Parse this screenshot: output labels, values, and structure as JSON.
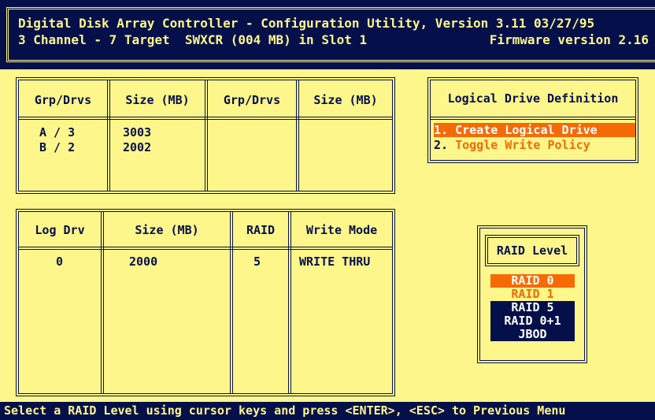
{
  "header": {
    "title_line1": "Digital Disk Array Controller - Configuration Utility, Version 3.11 03/27/95",
    "title_line2": "3 Channel - 7 Target  SWXCR (004 MB) in Slot 1",
    "firmware": "Firmware version 2.16"
  },
  "drive_groups": {
    "headers": [
      "Grp/Drvs",
      "Size (MB)",
      "Grp/Drvs",
      "Size (MB)"
    ],
    "rows": [
      {
        "grp": "A / 3",
        "size": "3003"
      },
      {
        "grp": "B / 2",
        "size": "2002"
      }
    ]
  },
  "logical_drives": {
    "headers": [
      "Log Drv",
      "Size (MB)",
      "RAID",
      "Write Mode"
    ],
    "rows": [
      {
        "log_drv": "0",
        "size": "2000",
        "raid": "5",
        "write_mode": "WRITE THRU"
      }
    ]
  },
  "menu": {
    "title": "Logical Drive Definition",
    "items": [
      {
        "num": "1.",
        "label": " Create Logical Drive"
      },
      {
        "num": "2.",
        "label": " Toggle Write Policy"
      }
    ]
  },
  "raid_level": {
    "title": "RAID Level",
    "options": [
      "RAID 0",
      "RAID 1",
      "RAID 5",
      "RAID 0+1",
      "JBOD"
    ],
    "selected": "RAID 0"
  },
  "status_bar": "Select a RAID Level using cursor keys and press <ENTER>, <ESC> to Previous Menu",
  "colors": {
    "background": "#fdf68a",
    "navy": "#05104a",
    "highlight": "#f56a06"
  }
}
